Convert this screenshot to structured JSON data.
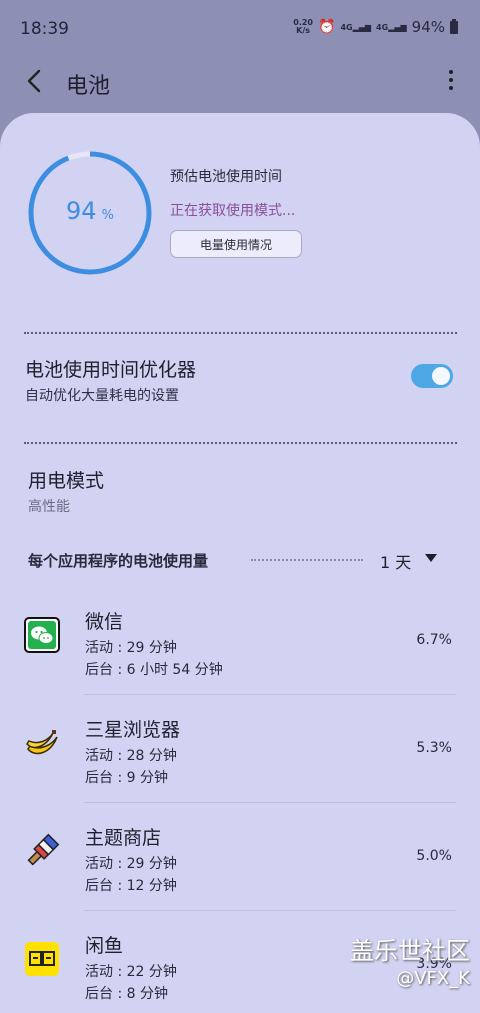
{
  "status_bar": {
    "time": "18:39",
    "net_speed_top": "0.20",
    "net_speed_bottom": "K/s",
    "signal1": "4G",
    "signal2": "4G",
    "battery": "94%"
  },
  "header": {
    "title": "电池"
  },
  "battery": {
    "level_percent": 94,
    "value": "94",
    "unit": "%",
    "estimate_label": "预估电池使用时间",
    "estimate_status": "正在获取使用模式...",
    "usage_button": "电量使用情况"
  },
  "optimizer": {
    "title": "电池使用时间优化器",
    "subtitle": "自动优化大量耗电的设置",
    "enabled": true
  },
  "power_mode": {
    "title": "用电模式",
    "value": "高性能"
  },
  "app_usage": {
    "title": "每个应用程序的电池使用量",
    "period": "1 天",
    "apps": [
      {
        "name": "微信",
        "active": "活动 : 29 分钟",
        "background": "后台 : 6 小时 54 分钟",
        "percent": "6.7%",
        "icon": "wechat-icon"
      },
      {
        "name": "三星浏览器",
        "active": "活动 : 28 分钟",
        "background": "后台 : 9 分钟",
        "percent": "5.3%",
        "icon": "banana-icon"
      },
      {
        "name": "主题商店",
        "active": "活动 : 29 分钟",
        "background": "后台 : 12 分钟",
        "percent": "5.0%",
        "icon": "paintbrush-icon"
      },
      {
        "name": "闲鱼",
        "active": "活动 : 22 分钟",
        "background": "后台 : 8 分钟",
        "percent": "3.9%",
        "icon": "xianyu-icon"
      }
    ]
  },
  "watermark": {
    "line1": "盖乐世社区",
    "line2": "@VFX_K"
  },
  "colors": {
    "accent": "#3d8ee0",
    "toggle": "#4ea8e6",
    "card_bg": "#d2d2f2",
    "page_bg": "#8e8fb5"
  }
}
